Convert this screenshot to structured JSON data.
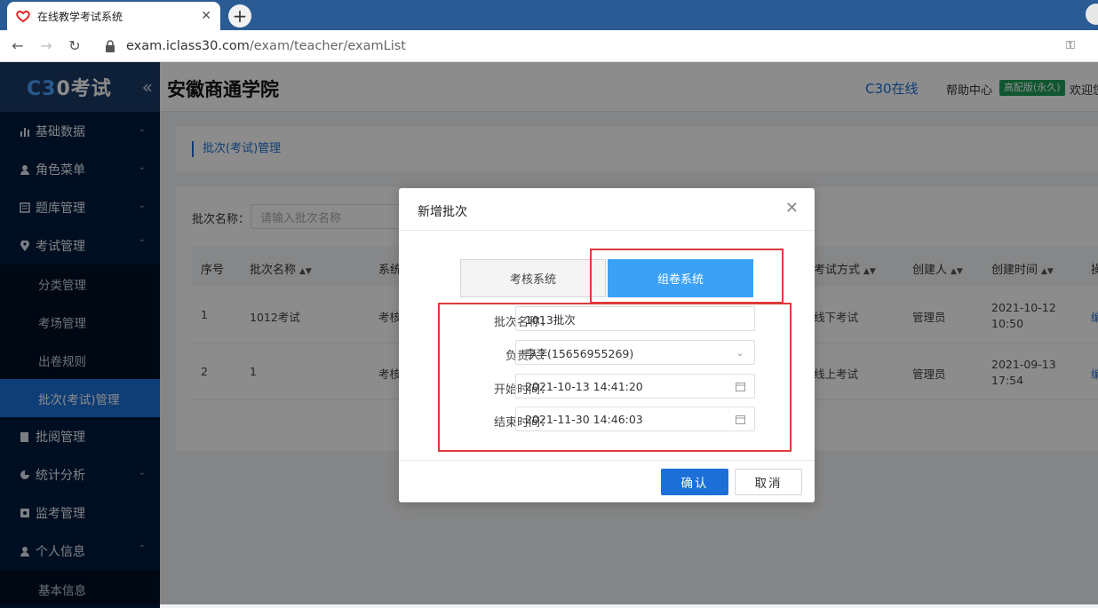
{
  "browser": {
    "tab_title": "在线教学考试系统",
    "url_host": "exam.iclass30.com",
    "url_path": "/exam/teacher/examList"
  },
  "sidebar": {
    "logo_c": "C3",
    "logo_text": "0考试",
    "menu": [
      {
        "label": "基础数据",
        "icon": "chart-bar-icon"
      },
      {
        "label": "角色菜单",
        "icon": "user-icon"
      },
      {
        "label": "题库管理",
        "icon": "list-icon"
      },
      {
        "label": "考试管理",
        "icon": "location-pin-icon"
      }
    ],
    "exam_submenu": [
      {
        "label": "分类管理"
      },
      {
        "label": "考场管理"
      },
      {
        "label": "出卷规则"
      },
      {
        "label": "批次(考试)管理"
      }
    ],
    "menu_after": [
      {
        "label": "批阅管理",
        "icon": "edit-icon"
      },
      {
        "label": "统计分析",
        "icon": "pie-chart-icon"
      },
      {
        "label": "监考管理",
        "icon": "monitor-icon"
      },
      {
        "label": "个人信息",
        "icon": "user-icon"
      }
    ],
    "personal_submenu": [
      {
        "label": "基本信息"
      }
    ]
  },
  "header": {
    "school_name": "安徽商通学院",
    "c30_link": "C30在线",
    "help": "帮助中心",
    "edition": "高配版(永久)",
    "welcome": "欢迎您"
  },
  "content": {
    "breadcrumb": "批次(考试)管理",
    "filter_label": "批次名称：",
    "filter_placeholder": "请输入批次名称",
    "columns": [
      "序号",
      "批次名称",
      "系统",
      "考试方式",
      "创建人",
      "创建时间",
      "操"
    ],
    "rows": [
      {
        "index": "1",
        "name": "1012考试",
        "system": "考核",
        "method": "线下考试",
        "creator": "管理员",
        "date": "2021-10-12",
        "time": "10:50",
        "action": "编"
      },
      {
        "index": "2",
        "name": "1",
        "system": "考核",
        "method": "线上考试",
        "creator": "管理员",
        "date": "2021-09-13",
        "time": "17:54",
        "action": "编"
      }
    ]
  },
  "modal": {
    "title": "新增批次",
    "seg_exam": "考核系统",
    "seg_paper": "组卷系统",
    "fields": {
      "batch_name_label": "批次名称：",
      "batch_name_value": "1013批次",
      "owner_label": "负责人：",
      "owner_value": "李李(15656955269)",
      "start_label": "开始时间：",
      "start_value": "2021-10-13 14:41:20",
      "end_label": "结束时间：",
      "end_value": "2021-11-30 14:46:03"
    },
    "confirm": "确认",
    "cancel": "取消"
  },
  "colors": {
    "sidebar_bg": "#001b3d",
    "accent": "#1d6fd8",
    "segment_active": "#3ba1f7",
    "highlight_box": "#e03a3a",
    "badge": "#1e9e5a"
  }
}
